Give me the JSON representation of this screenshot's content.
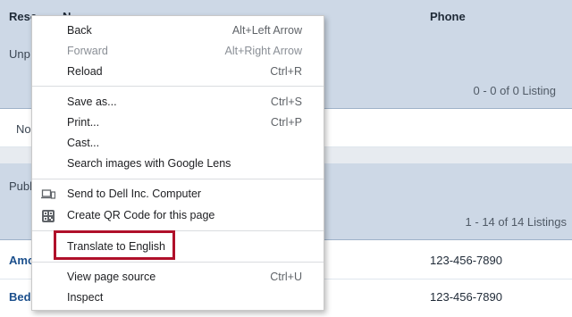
{
  "table": {
    "headers": [
      "Resc",
      "N",
      "Phone"
    ],
    "sections": [
      {
        "label": "Unp",
        "count": "0 - 0 of 0 Listing",
        "empty_text": "No"
      },
      {
        "label": "Publ",
        "count": "1 - 14 of 14 Listings"
      }
    ],
    "rows": [
      {
        "name": "Amc",
        "phone": "123-456-7890"
      },
      {
        "name": "Bed",
        "phone": "123-456-7890"
      }
    ]
  },
  "context_menu": {
    "items": [
      {
        "label": "Back",
        "shortcut": "Alt+Left Arrow"
      },
      {
        "label": "Forward",
        "shortcut": "Alt+Right Arrow",
        "disabled": true
      },
      {
        "label": "Reload",
        "shortcut": "Ctrl+R"
      },
      {
        "label": "Save as...",
        "shortcut": "Ctrl+S"
      },
      {
        "label": "Print...",
        "shortcut": "Ctrl+P"
      },
      {
        "label": "Cast...",
        "shortcut": ""
      },
      {
        "label": "Search images with Google Lens",
        "shortcut": ""
      },
      {
        "label": "Send to Dell Inc. Computer",
        "shortcut": "",
        "icon": "laptop-phone-icon"
      },
      {
        "label": "Create QR Code for this page",
        "shortcut": "",
        "icon": "qr-code-icon"
      },
      {
        "label": "Translate to English",
        "shortcut": "",
        "highlighted": true
      },
      {
        "label": "View page source",
        "shortcut": "Ctrl+U"
      },
      {
        "label": "Inspect",
        "shortcut": ""
      }
    ],
    "highlight_color": "#b0102a"
  }
}
